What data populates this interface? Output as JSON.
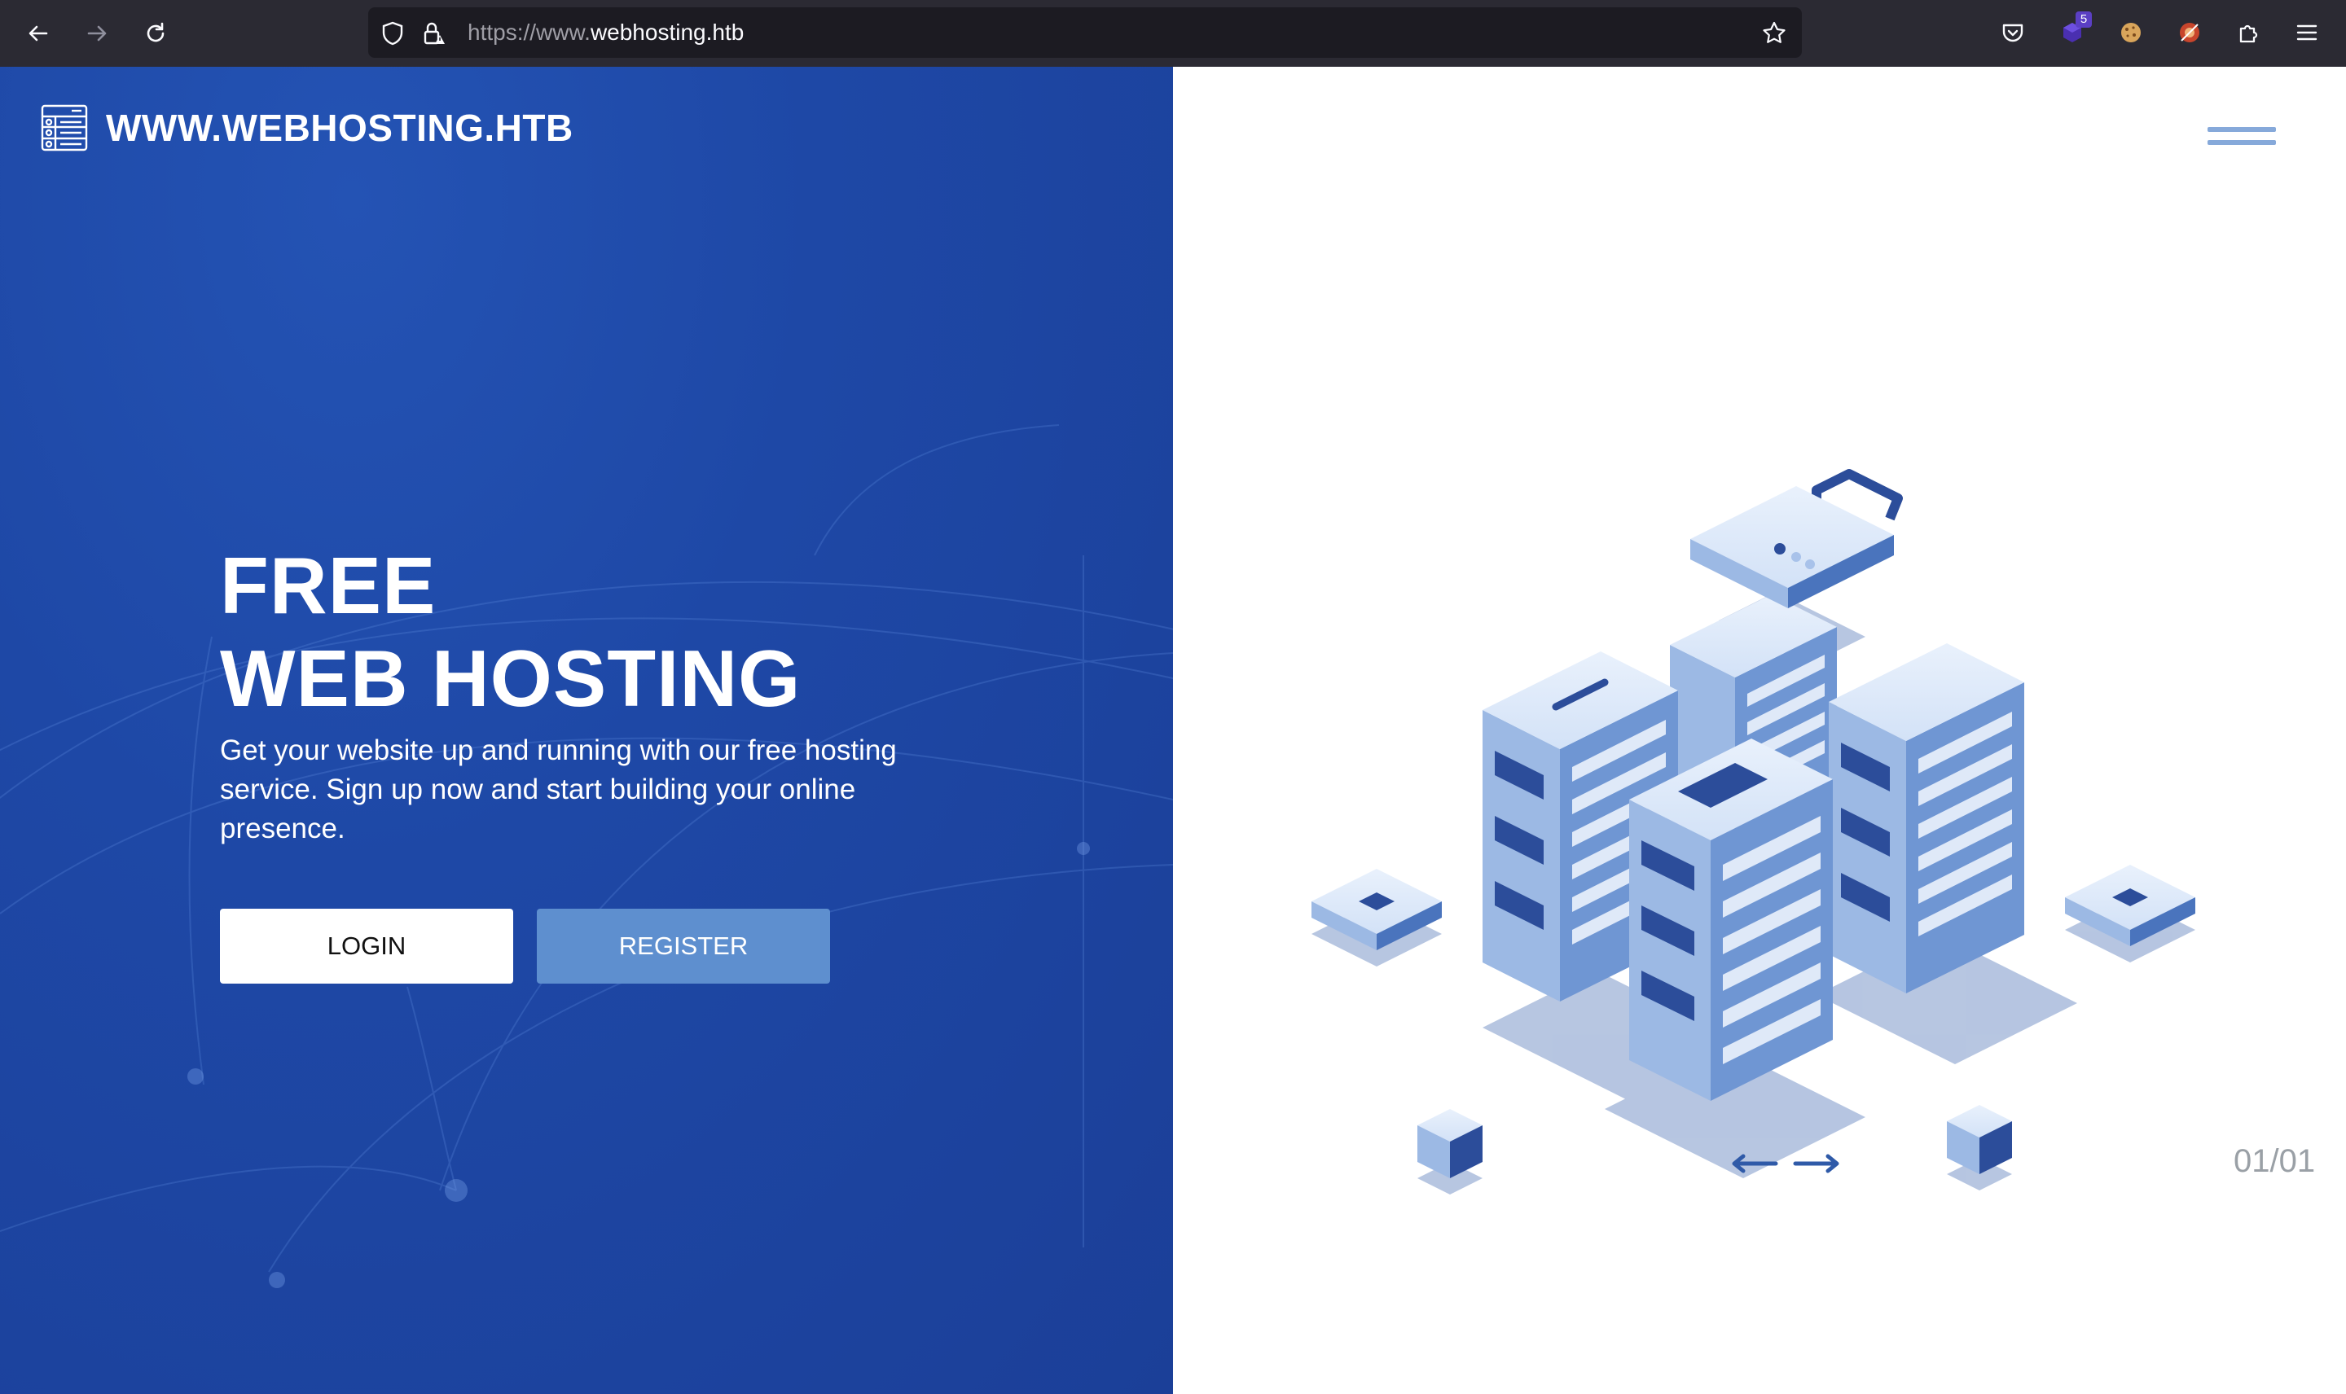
{
  "browser": {
    "url_prefix": "https://www.",
    "url_domain": "webhosting.htb",
    "extension_badge": "5"
  },
  "site": {
    "brand": "WWW.WEBHOSTING.HTB",
    "headline_line1": "FREE",
    "headline_line2": "WEB HOSTING",
    "description": "Get your website up and running with our free hosting service. Sign up now and start building your online presence.",
    "login_label": "LOGIN",
    "register_label": "REGISTER",
    "slide_counter": "01/01"
  },
  "colors": {
    "hero_blue": "#1e48a6",
    "register_button": "#5e8fcf",
    "illustration_accent": "#2c4d9a"
  }
}
